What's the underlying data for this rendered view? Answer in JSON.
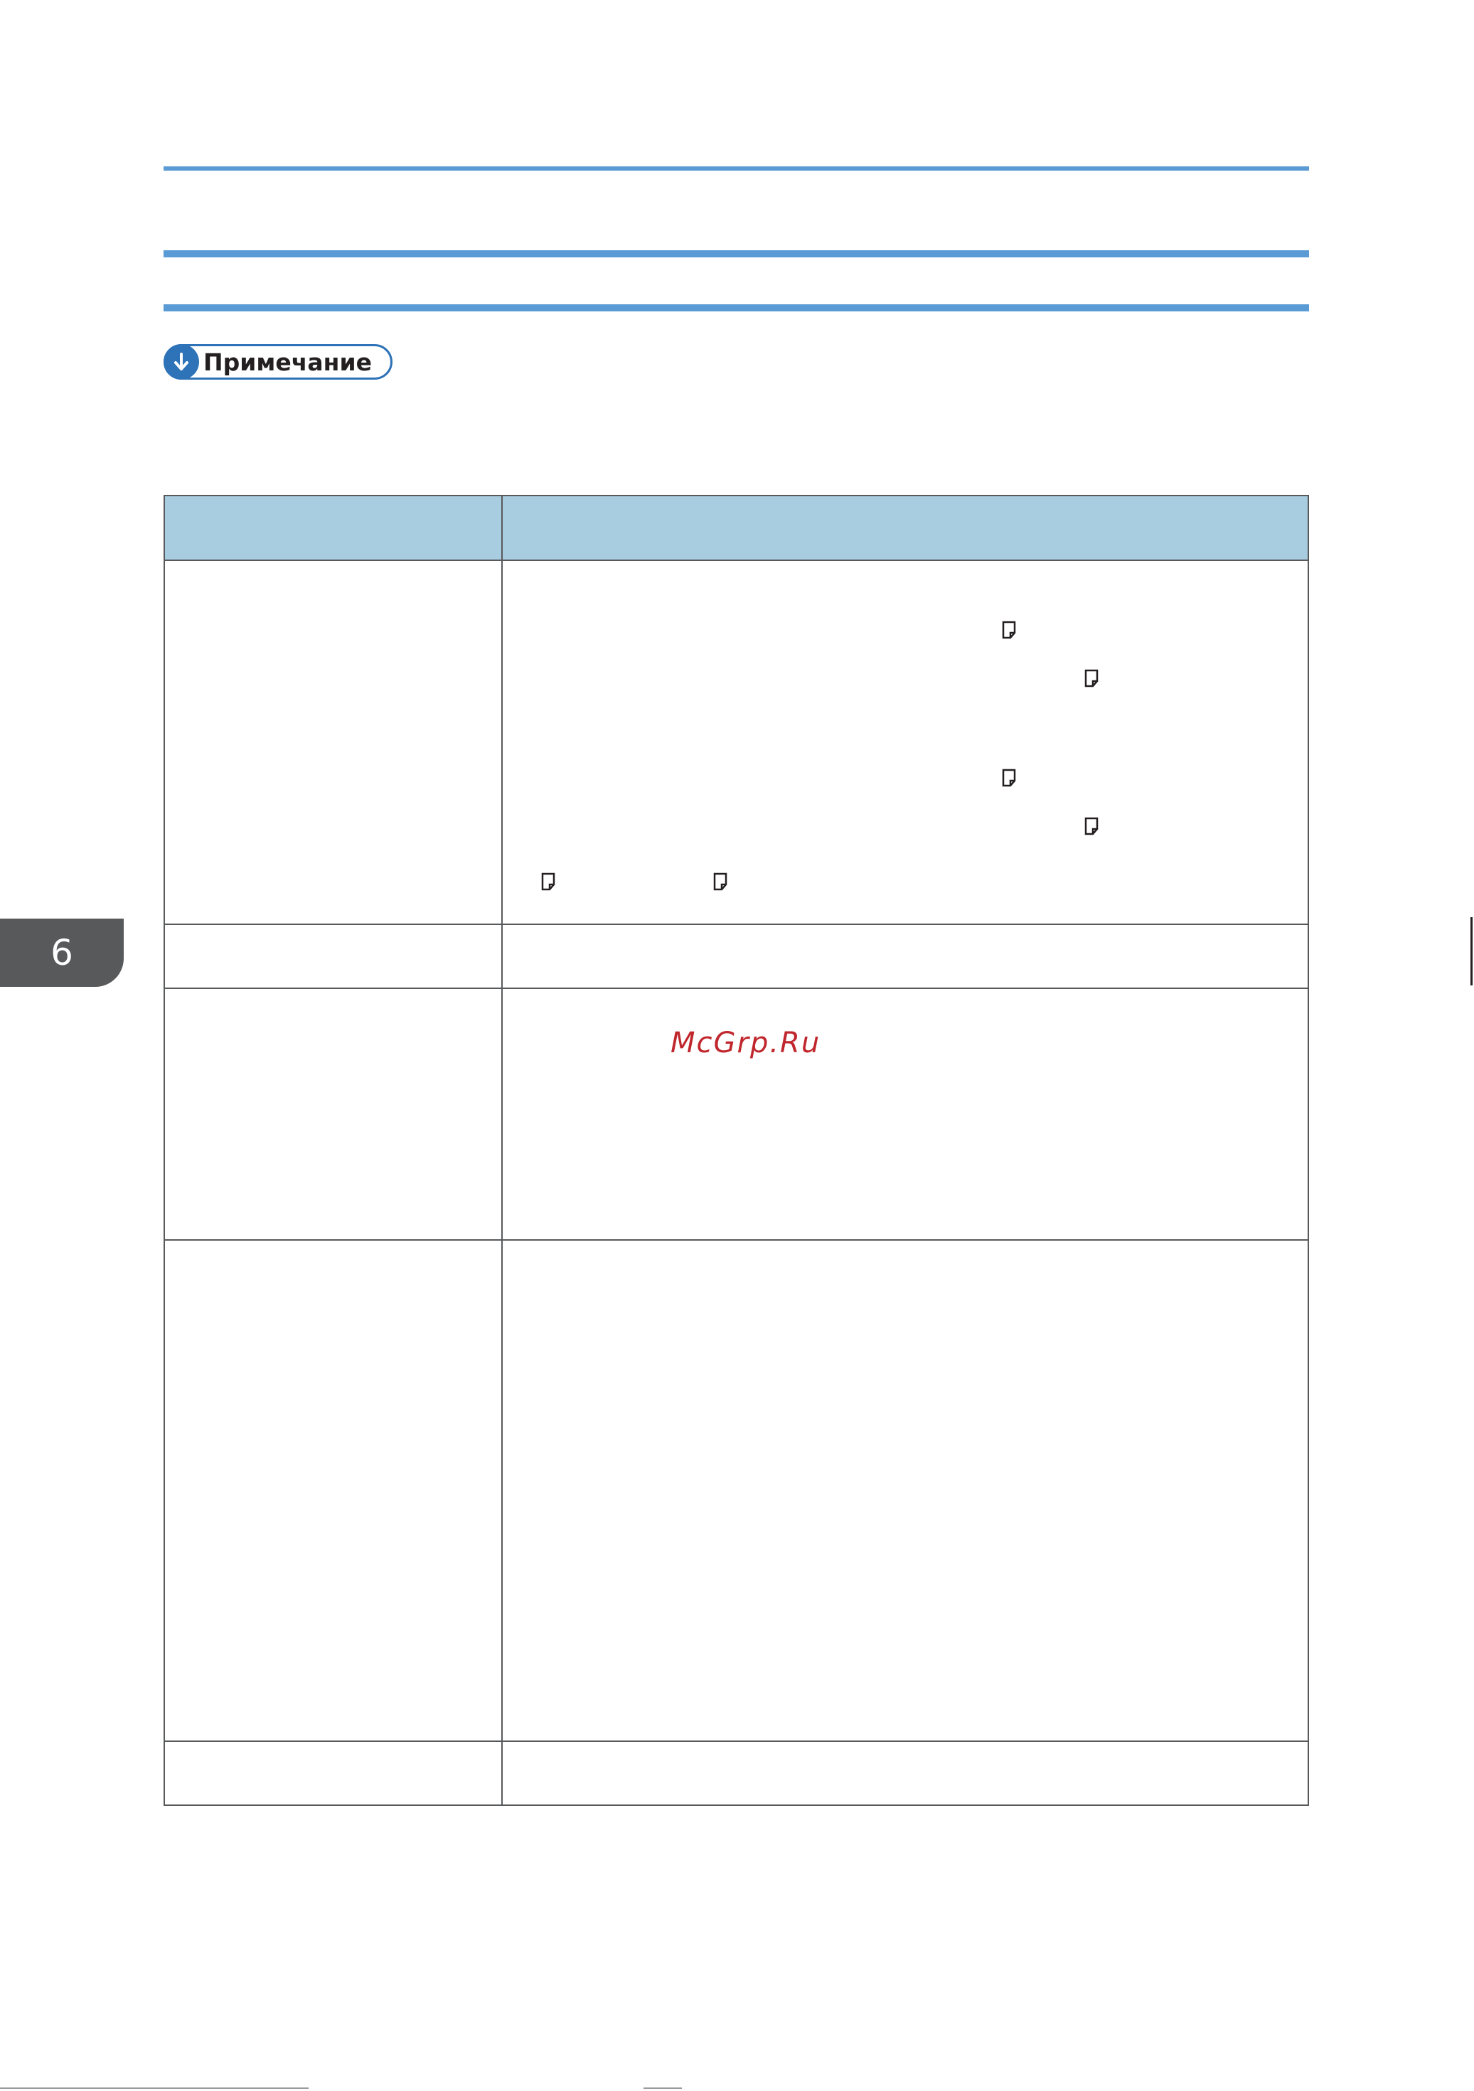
{
  "note": {
    "label": "Примечание",
    "icon": "arrow-down-circle-icon",
    "color": "#2e73b8"
  },
  "chapter": {
    "number": "6"
  },
  "watermark": {
    "text": "McGrp.Ru",
    "color": "#c0272d"
  },
  "colors": {
    "rule": "#5b9bd5",
    "table_header": "#a8cde0",
    "chapter_tab": "#58595b"
  },
  "paper_icon": "paper-orientation-icon"
}
